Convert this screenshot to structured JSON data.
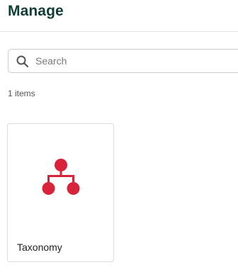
{
  "header": {
    "title": "Manage"
  },
  "search": {
    "placeholder": "Search",
    "value": "",
    "icon": "search-icon"
  },
  "results": {
    "count_label": "1 items"
  },
  "items": [
    {
      "label": "Taxonomy",
      "icon": "hierarchy-icon",
      "icon_color": "#d9233a"
    }
  ],
  "colors": {
    "title": "#123d34",
    "accent": "#d9233a"
  }
}
